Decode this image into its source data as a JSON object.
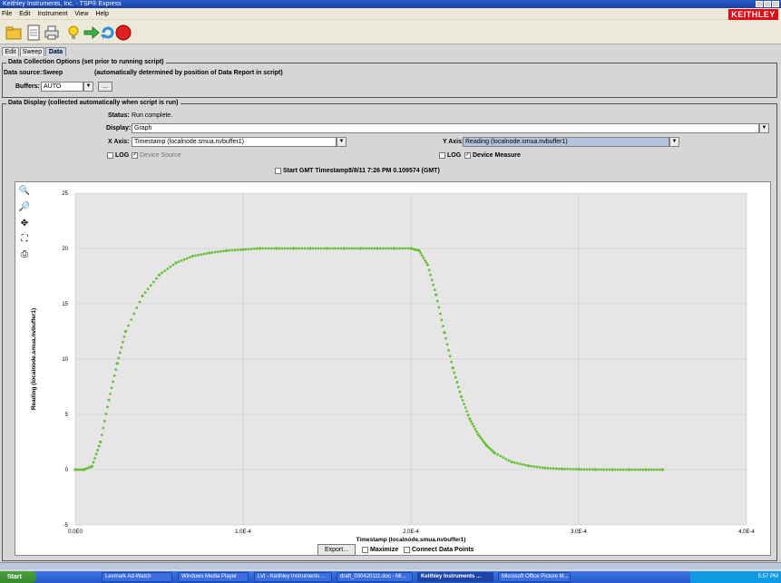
{
  "window": {
    "title": "Keithley Instruments, Inc. - TSP® Express",
    "logo": "KEITHLEY"
  },
  "menu": [
    "File",
    "Edit",
    "Instrument",
    "View",
    "Help"
  ],
  "toolbar_icons": [
    "folder-icon",
    "document-icon",
    "print-icon",
    "lightbulb-icon",
    "run-arrow-icon",
    "refresh-icon",
    "stop-icon"
  ],
  "tabs": [
    "Edit",
    "Sweep",
    "Data"
  ],
  "collection": {
    "group_label": "Data Collection Options (set prior to running script)",
    "source_label": "Data source:",
    "source_value": "Sweep",
    "source_note": "(automatically determined by position of Data Report in script)",
    "buffers_label": "Buffers:",
    "buffers_value": "AUTO",
    "more_button": "..."
  },
  "display": {
    "group_label": "Data Display (collected automatically when script is run)",
    "status_label": "Status:",
    "status_value": "Run complete.",
    "display_label": "Display:",
    "display_value": "Graph",
    "xaxis_label": "X Axis:",
    "xaxis_value": "Timestamp (localnode.smua.nvbuffer1)",
    "yaxis_label": "Y Axis:",
    "yaxis_value": "Reading (localnode.smua.nvbuffer1)",
    "x_log": "LOG",
    "x_device": "Device Source",
    "y_log": "LOG",
    "y_device": "Device Measure",
    "gmt_label": "Start GMT Timestamp:",
    "gmt_value": "3/8/11 7:26 PM 0.109574 (GMT)"
  },
  "chart_data": {
    "type": "scatter",
    "xlabel": "Timestamp (localnode.smua.nvbuffer1)",
    "ylabel": "Reading (localnode.smua.nvbuffer1)",
    "xlim": [
      0,
      0.0004
    ],
    "ylim": [
      -5,
      25
    ],
    "xticks": [
      "0.0E0",
      "1.0E-4",
      "2.0E-4",
      "3.0E-4",
      "4.0E-4"
    ],
    "yticks": [
      "-5",
      "0",
      "5",
      "10",
      "15",
      "20",
      "25"
    ],
    "color": "#6abf3a",
    "grid": true,
    "series": [
      {
        "x": [
          0.0,
          5e-06,
          1e-05,
          1.5e-05,
          2e-05,
          2.5e-05,
          3e-05,
          4e-05,
          5e-05,
          6e-05,
          7e-05,
          8e-05,
          9e-05,
          0.0001,
          0.00011,
          0.00012,
          0.00013,
          0.00014,
          0.00015,
          0.00016,
          0.00017,
          0.00018,
          0.00019,
          0.0002,
          0.000205,
          0.00021,
          0.000215,
          0.00022,
          0.000225,
          0.00023,
          0.000235,
          0.00024,
          0.000245,
          0.00025,
          0.00026,
          0.00027,
          0.00028,
          0.00029,
          0.0003,
          0.00031,
          0.00032,
          0.00033,
          0.00034,
          0.00035
        ],
        "y": [
          0.0,
          0.0,
          0.3,
          2.5,
          6.3,
          9.6,
          12.5,
          15.7,
          17.6,
          18.7,
          19.3,
          19.6,
          19.8,
          19.9,
          20.0,
          20.0,
          20.0,
          20.0,
          20.0,
          20.0,
          20.0,
          20.0,
          20.0,
          20.0,
          19.8,
          18.5,
          15.8,
          12.4,
          9.2,
          6.6,
          4.6,
          3.2,
          2.2,
          1.5,
          0.7,
          0.35,
          0.15,
          0.07,
          0.03,
          0.01,
          0.0,
          0.0,
          0.0,
          0.0
        ]
      }
    ]
  },
  "bottom": {
    "export": "Export...",
    "maximize": "Maximize",
    "connect": "Connect Data Points"
  },
  "taskbar": {
    "start": "Start",
    "tasks": [
      "Lexmark Ad-Watch",
      "Windows Media Player",
      "LVI - Keithley Instruments ...",
      "draft_030420111.doc - Mi...",
      "Keithley Instruments ...",
      "Microsoft Office Picture M..."
    ],
    "clock": "5:57 PM"
  }
}
